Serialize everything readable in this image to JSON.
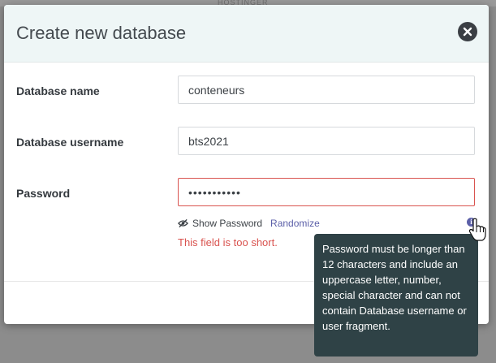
{
  "background": {
    "peek_text": "HOSTINGER"
  },
  "modal": {
    "title": "Create new database",
    "close_icon": "close-circle-icon",
    "fields": {
      "db_name": {
        "label": "Database name",
        "value": "conteneurs"
      },
      "db_user": {
        "label": "Database username",
        "value": "bts2021"
      },
      "password": {
        "label": "Password",
        "value": "•••••••••••"
      }
    },
    "password_tools": {
      "show_password": "Show Password",
      "randomize": "Randomize",
      "info": "i"
    },
    "error": "This field is too short.",
    "tooltip": "Password must be longer than 12 characters and include an uppercase letter, number, special character and can not contain Database username or user fragment."
  },
  "colors": {
    "accent": "#5b5fa8",
    "error": "#d9534f",
    "tooltip_bg": "#2f4246",
    "header_bg": "#eef6f6"
  }
}
